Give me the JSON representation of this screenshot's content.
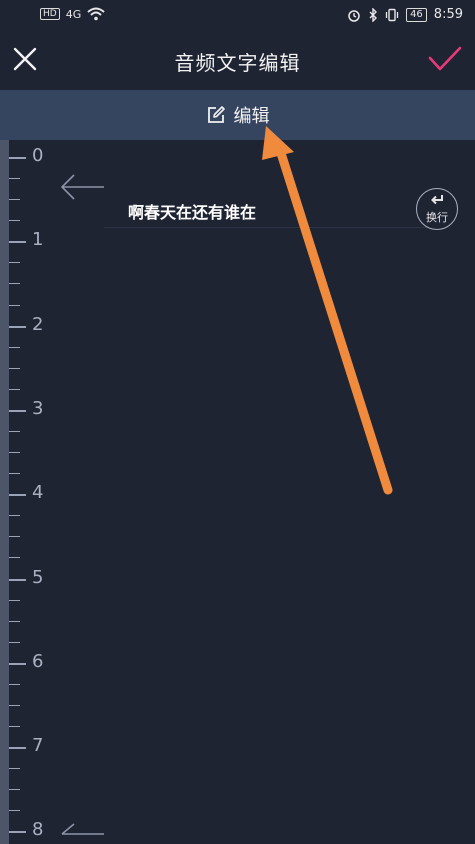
{
  "status_bar": {
    "hd": "HD",
    "network": "4G",
    "battery": "46",
    "time": "8:59"
  },
  "header": {
    "title": "音频文字编辑"
  },
  "edit_bar": {
    "label": "编辑"
  },
  "ruler": {
    "labels": [
      "0",
      "1",
      "2",
      "3",
      "4",
      "5",
      "6",
      "7",
      "8"
    ]
  },
  "caption": {
    "text": "啊春天在还有谁在"
  },
  "wrap_button": {
    "label": "换行"
  },
  "colors": {
    "background": "#1f2433",
    "edit_bar": "#35445f",
    "confirm_check": "#e83a7a",
    "annotation_arrow": "#f08a3c"
  },
  "icons": {
    "close": "close-icon",
    "confirm": "check-icon",
    "edit": "edit-icon",
    "wrap": "return-icon",
    "back": "arrow-left-icon"
  }
}
